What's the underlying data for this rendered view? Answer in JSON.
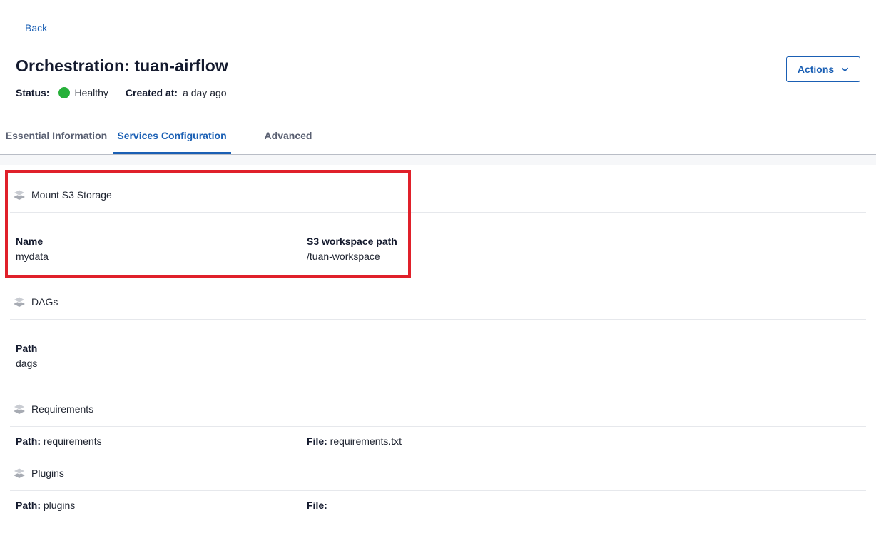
{
  "nav": {
    "back_label": "Back"
  },
  "header": {
    "title": "Orchestration: tuan-airflow",
    "status_label": "Status:",
    "status_value": "Healthy",
    "status_color": "#27b03a",
    "created_label": "Created at:",
    "created_value": "a day ago",
    "actions_label": "Actions"
  },
  "tabs": [
    {
      "label": "Essential Information",
      "active": false
    },
    {
      "label": "Services Configuration",
      "active": true
    },
    {
      "label": "Advanced",
      "active": false
    }
  ],
  "sections": {
    "mount_s3": {
      "title": "Mount S3 Storage",
      "icon": "layers-icon",
      "name_label": "Name",
      "name_value": "mydata",
      "path_label": "S3 workspace path",
      "path_value": "/tuan-workspace"
    },
    "dags": {
      "title": "DAGs",
      "icon": "layers-icon",
      "path_label": "Path",
      "path_value": "dags"
    },
    "requirements": {
      "title": "Requirements",
      "icon": "layers-icon",
      "path_label": "Path:",
      "path_value": "requirements",
      "file_label": "File:",
      "file_value": "requirements.txt"
    },
    "plugins": {
      "title": "Plugins",
      "icon": "layers-icon",
      "path_label": "Path:",
      "path_value": "plugins",
      "file_label": "File:",
      "file_value": ""
    }
  },
  "colors": {
    "accent": "#1a5fb4",
    "highlight": "#e0202a",
    "healthy": "#27b03a"
  }
}
